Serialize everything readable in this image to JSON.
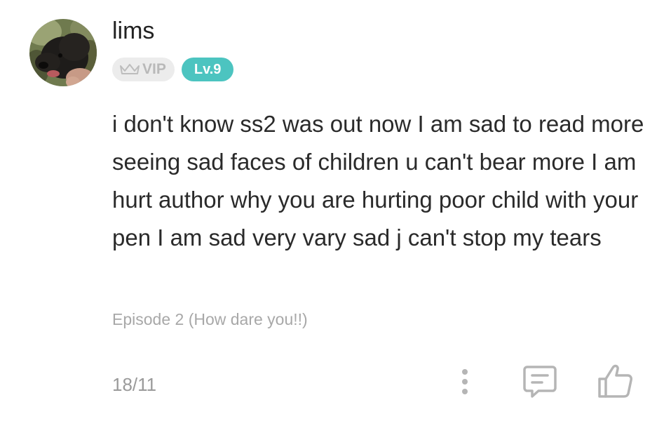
{
  "comment": {
    "user": {
      "name": "lims",
      "vip_label": "VIP",
      "level_label": "Lv.9"
    },
    "text": "i don't know ss2 was out now I am sad to read more seeing sad faces of children u can't bear more I am hurt author why you are hurting poor child with your pen I am sad very vary sad j can't stop my tears",
    "episode": "Episode 2 (How dare you!!)",
    "date": "18/11"
  },
  "icons": {
    "avatar": "dog-avatar",
    "vip": "crown-icon",
    "more": "more-vertical-icon",
    "reply": "reply-icon",
    "like": "thumbs-up-icon"
  },
  "colors": {
    "level_badge": "#4cc4c0",
    "vip_badge_bg": "#ececec",
    "vip_badge_text": "#b9b9b9",
    "muted_text": "#a8a8a8"
  }
}
